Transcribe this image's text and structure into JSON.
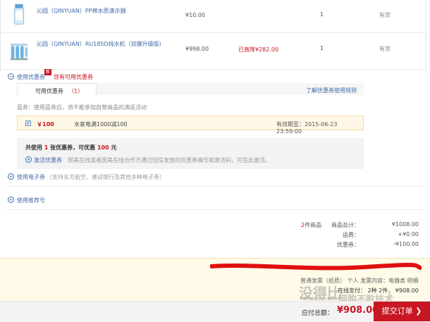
{
  "products": [
    {
      "name": "沁园（QINYUAN）PP棉水质演示器",
      "price": "¥10.00",
      "qty": "1",
      "stock": "有货",
      "drop": ""
    },
    {
      "name": "沁园（QINYUAN）RU185D纯水机（双膜升级版）",
      "price": "¥998.00",
      "qty": "1",
      "stock": "有货",
      "drop": "已直降¥282.00"
    }
  ],
  "coupon_section": {
    "toggle_label": "使用优惠券",
    "badge": "新",
    "available_msg": "您有可用优惠券",
    "tab_label": "可用优惠券",
    "tab_count": "（1）",
    "rules_link": "了解优惠券使用规则",
    "blue_coupon_note": "蓝券：使用蓝券后，将不能参加自营商品的满返活动",
    "coupon": {
      "checked": "✓",
      "amount": "￥100",
      "desc": "水家电满1000减100",
      "expiry": "有效期至：2015-06-23 23:59:00"
    },
    "summary_prefix": "共使用 ",
    "summary_count": "1",
    "summary_mid": " 张优惠券，可优惠 ",
    "summary_amount": "100",
    "summary_suffix": " 元",
    "activate_label": "激活优惠券",
    "activate_desc": "国美在线或者国美在线合作方通过短信发放的优惠券编号和激活码，可在此激活。"
  },
  "ecard_section": {
    "label": "使用电子券",
    "desc": "（支持东方航空，建设银行及其他多种电子券）"
  },
  "referrer_section": {
    "label": "使用推荐号"
  },
  "totals": {
    "count": "2",
    "count_suffix": "件商品",
    "goods_label": "商品总计：",
    "goods_value": "¥1008.00",
    "shipping_label": "运费：",
    "shipping_value": "+¥0.00",
    "coupon_label": "优惠券：",
    "coupon_value": "-¥100.00"
  },
  "footer": {
    "invoice_line": "普通发票（纸质） 个人 发票内容：电器类 明细",
    "ship_line": "在线支付： 2种 2件， ¥908.00",
    "due_label": "应付总额：",
    "due_value": "¥908.00",
    "submit_label": "提交订单 ❯"
  },
  "colors": {
    "accent_red": "#c81623",
    "link_blue": "#3f6aa8"
  }
}
